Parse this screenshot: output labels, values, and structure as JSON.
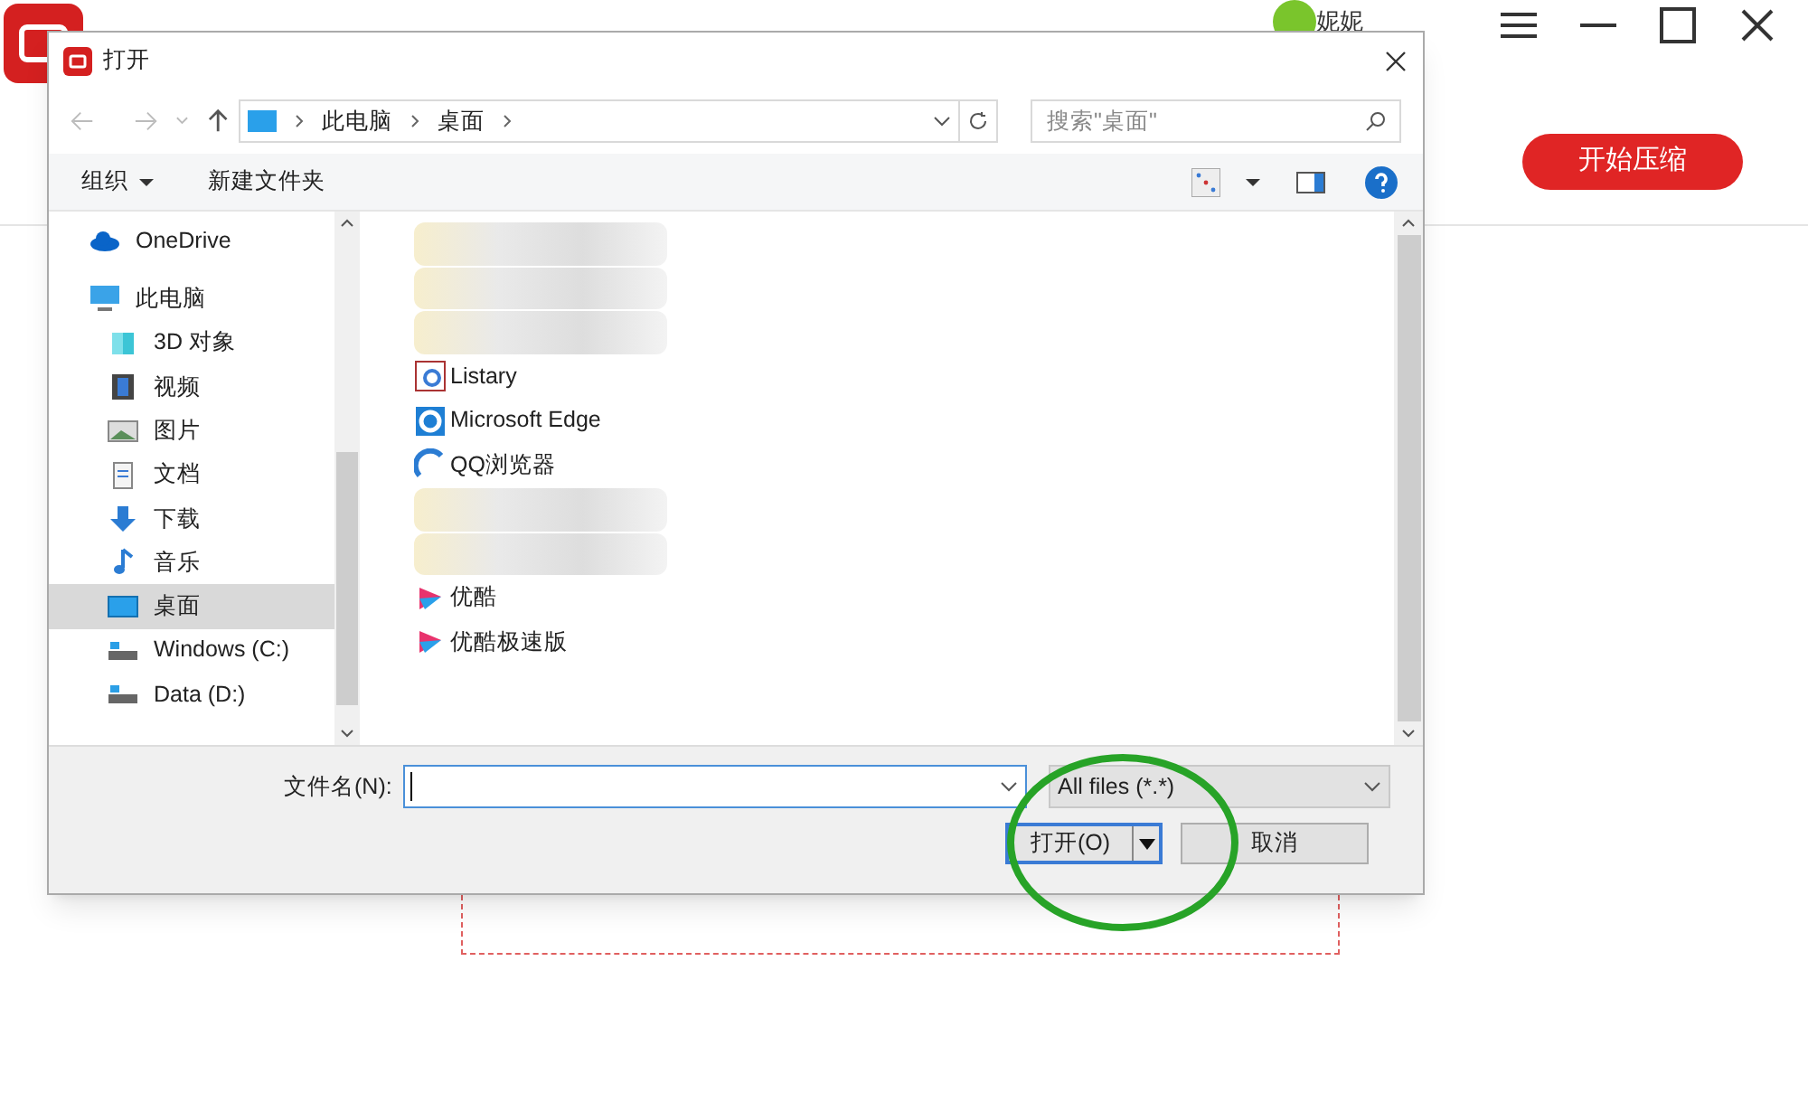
{
  "app": {
    "user": "妮妮",
    "start_button": "开始压缩"
  },
  "dialog": {
    "title": "打开",
    "breadcrumb": [
      "此电脑",
      "桌面"
    ],
    "search": {
      "placeholder": "搜索\"桌面\""
    },
    "toolbar": [
      "组织",
      "新建文件夹"
    ],
    "nav": [
      {
        "label": "OneDrive",
        "kind": "cloud",
        "selected": false
      },
      {
        "label": "此电脑",
        "kind": "pc",
        "selected": false,
        "children": [
          {
            "label": "3D 对象",
            "kind": "cube",
            "selected": false
          },
          {
            "label": "视频",
            "kind": "film",
            "selected": false
          },
          {
            "label": "图片",
            "kind": "image",
            "selected": false
          },
          {
            "label": "文档",
            "kind": "doc",
            "selected": false
          },
          {
            "label": "下载",
            "kind": "download",
            "selected": false
          },
          {
            "label": "音乐",
            "kind": "music",
            "selected": false
          },
          {
            "label": "桌面",
            "kind": "desktop",
            "selected": true
          },
          {
            "label": "Windows (C:)",
            "kind": "drive",
            "selected": false
          },
          {
            "label": "Data (D:)",
            "kind": "drive",
            "selected": false
          }
        ]
      }
    ],
    "files": [
      {
        "kind": "blurred"
      },
      {
        "kind": "blurred"
      },
      {
        "kind": "blurred"
      },
      {
        "kind": "listary",
        "name": "Listary"
      },
      {
        "kind": "edge",
        "name": "Microsoft Edge"
      },
      {
        "kind": "qq",
        "name": "QQ浏览器"
      },
      {
        "kind": "blurred"
      },
      {
        "kind": "blurred"
      },
      {
        "kind": "youku",
        "name": "优酷"
      },
      {
        "kind": "youku",
        "name": "优酷极速版"
      }
    ],
    "filename_label": "文件名(N):",
    "filetype": "All files (*.*)",
    "open_button": "打开(O)",
    "cancel_button": "取消"
  }
}
